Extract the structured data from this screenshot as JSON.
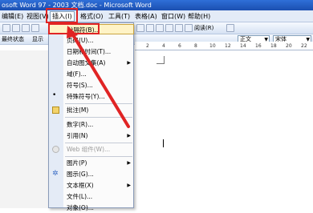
{
  "window": {
    "title": "osoft Word 97 - 2003 文档.doc - Microsoft Word"
  },
  "menu": {
    "items": [
      "编辑(E)",
      "视图(V)",
      "插入(I)",
      "格式(O)",
      "工具(T)",
      "表格(A)",
      "窗口(W)",
      "帮助(H)"
    ],
    "active_index": 2
  },
  "toolbar2": {
    "left_label": "显示",
    "style_combo": "正文",
    "font_combo": "宋体",
    "read_label": "阅读(R)",
    "left_label2": "最终状态"
  },
  "ruler": {
    "ticks": [
      "2",
      "4",
      "6",
      "8",
      "10",
      "12",
      "14",
      "16",
      "18",
      "20",
      "22"
    ]
  },
  "insert_menu": {
    "items": [
      {
        "label": "分隔符(B)...",
        "submenu": false,
        "highlight": true
      },
      {
        "label": "页码(U)...",
        "submenu": false
      },
      {
        "label": "日期和时间(T)...",
        "submenu": false
      },
      {
        "label": "自动图文集(A)",
        "submenu": true
      },
      {
        "label": "域(F)...",
        "submenu": false
      },
      {
        "label": "符号(S)...",
        "submenu": false
      },
      {
        "label": "特殊符号(Y)...",
        "submenu": false,
        "icon": "bullet"
      },
      {
        "label": "批注(M)",
        "submenu": false,
        "icon": "comment",
        "sep_before": true
      },
      {
        "label": "数字(R)...",
        "submenu": false,
        "sep_before": true
      },
      {
        "label": "引用(N)",
        "submenu": true
      },
      {
        "label": "Web 组件(W)...",
        "submenu": false,
        "disabled": true,
        "icon": "web",
        "sep_before": true
      },
      {
        "label": "图片(P)",
        "submenu": true,
        "sep_before": true
      },
      {
        "label": "图示(G)...",
        "submenu": false,
        "icon": "diagram"
      },
      {
        "label": "文本框(X)",
        "submenu": true
      },
      {
        "label": "文件(L)...",
        "submenu": false
      },
      {
        "label": "对象(O)...",
        "submenu": false
      }
    ]
  },
  "colors": {
    "annotation": "#e02424",
    "highlight": "#fff3c6",
    "menubar": "#e3ebf7"
  }
}
